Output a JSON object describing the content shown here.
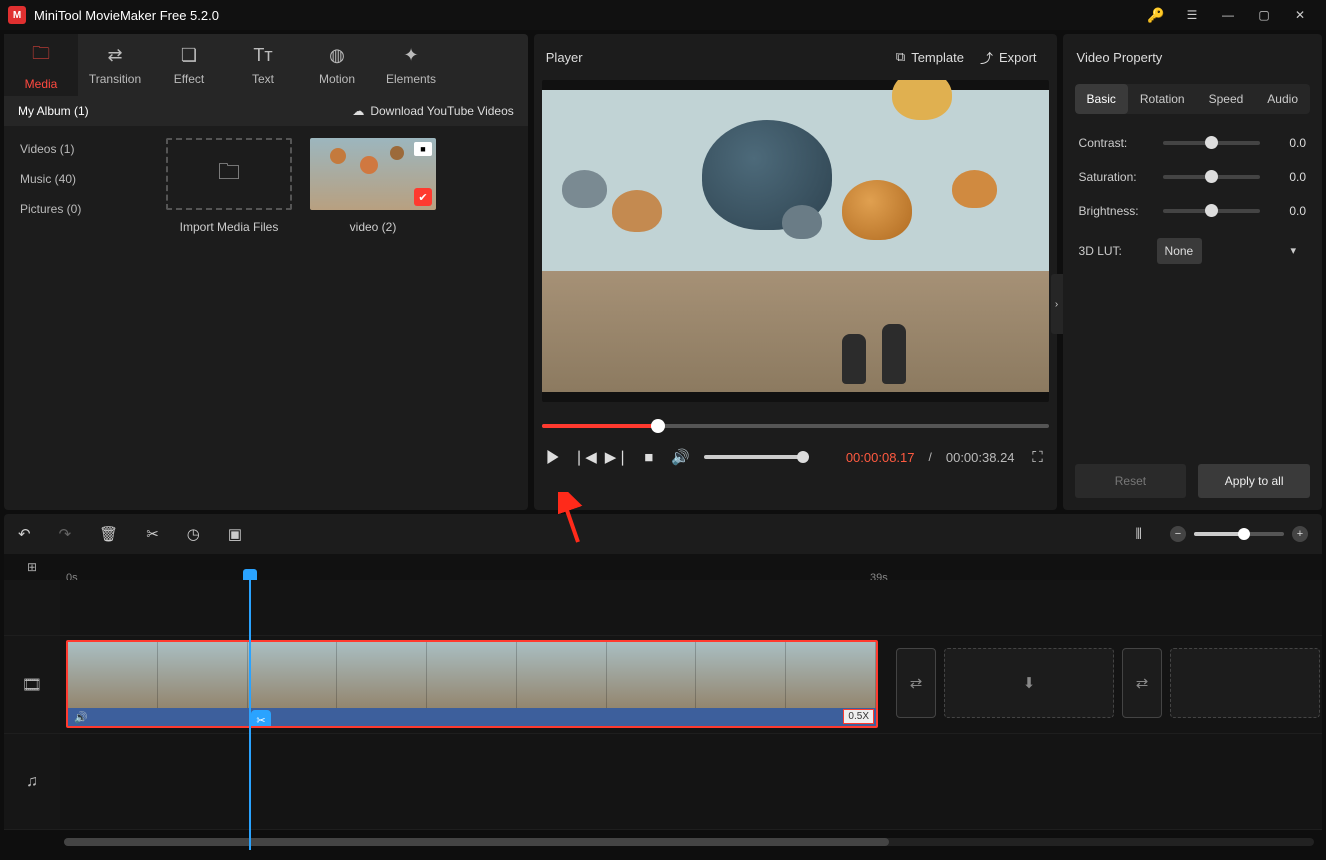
{
  "app": {
    "title": "MiniTool MovieMaker Free 5.2.0"
  },
  "tabs": {
    "media": {
      "label": "Media",
      "icon": "folder-icon"
    },
    "transition": {
      "label": "Transition",
      "icon": "swap-icon"
    },
    "effect": {
      "label": "Effect",
      "icon": "layers-icon"
    },
    "text": {
      "label": "Text",
      "icon": "text-icon"
    },
    "motion": {
      "label": "Motion",
      "icon": "motion-icon"
    },
    "elements": {
      "label": "Elements",
      "icon": "sparkle-icon"
    }
  },
  "album": {
    "name": "My Album (1)",
    "download": "Download YouTube Videos"
  },
  "categories": [
    {
      "label": "Videos (1)"
    },
    {
      "label": "Music (40)"
    },
    {
      "label": "Pictures (0)"
    }
  ],
  "import": {
    "label": "Import Media Files"
  },
  "media_items": [
    {
      "name": "video (2)",
      "checked": true
    }
  ],
  "player": {
    "title": "Player",
    "template": "Template",
    "export": "Export",
    "time_current": "00:00:08.17",
    "time_sep": "/",
    "time_total": "00:00:38.24",
    "progress_pct": 23
  },
  "property": {
    "title": "Video Property",
    "tabs": {
      "basic": "Basic",
      "rotation": "Rotation",
      "speed": "Speed",
      "audio": "Audio",
      "active": "basic"
    },
    "contrast": {
      "label": "Contrast:",
      "value": "0.0"
    },
    "saturation": {
      "label": "Saturation:",
      "value": "0.0"
    },
    "brightness": {
      "label": "Brightness:",
      "value": "0.0"
    },
    "lut": {
      "label": "3D LUT:",
      "value": "None"
    },
    "reset": "Reset",
    "apply": "Apply to all"
  },
  "timeline": {
    "start_label": "0s",
    "mark_39": "39s",
    "speed_badge": "0.5X"
  }
}
